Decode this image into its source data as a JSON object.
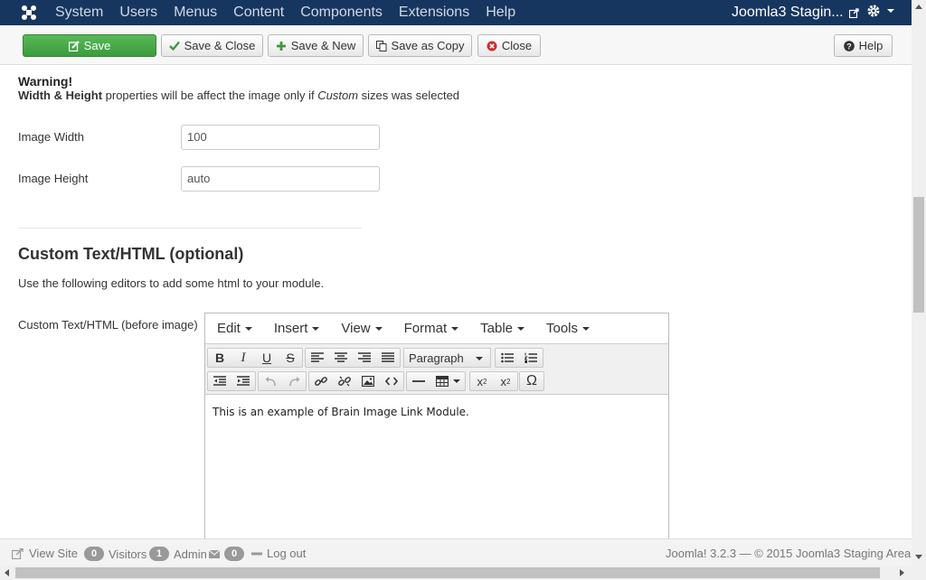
{
  "navbar": {
    "menu": [
      "System",
      "Users",
      "Menus",
      "Content",
      "Components",
      "Extensions",
      "Help"
    ],
    "site_name": "Joomla3 Stagin...",
    "bg_color": "#17365f"
  },
  "toolbar": {
    "save": "Save",
    "save_close": "Save & Close",
    "save_new": "Save & New",
    "save_copy": "Save as Copy",
    "close": "Close",
    "help": "Help"
  },
  "warning": {
    "title": "Warning!",
    "bold": "Width & Height",
    "text1": " properties will be affect the image only if ",
    "italic": "Custom",
    "text2": " sizes was selected"
  },
  "fields": {
    "width_label": "Image Width",
    "width_value": "100",
    "height_label": "Image Height",
    "height_value": "auto"
  },
  "custom": {
    "title": "Custom Text/HTML (optional)",
    "desc": "Use the following editors to add some html to your module.",
    "before_label": "Custom Text/HTML (before image)"
  },
  "editor": {
    "menu": [
      "Edit",
      "Insert",
      "View",
      "Format",
      "Table",
      "Tools"
    ],
    "format_select": "Paragraph",
    "content": "This is an example of Brain Image Link Module."
  },
  "status": {
    "view_site": "View Site",
    "visitors_count": "0",
    "visitors": "Visitors",
    "admin_count": "1",
    "admin": "Admin",
    "messages_count": "0",
    "logout": "Log out",
    "footer": "Joomla! 3.2.3  —  © 2015 Joomla3 Staging Area"
  }
}
